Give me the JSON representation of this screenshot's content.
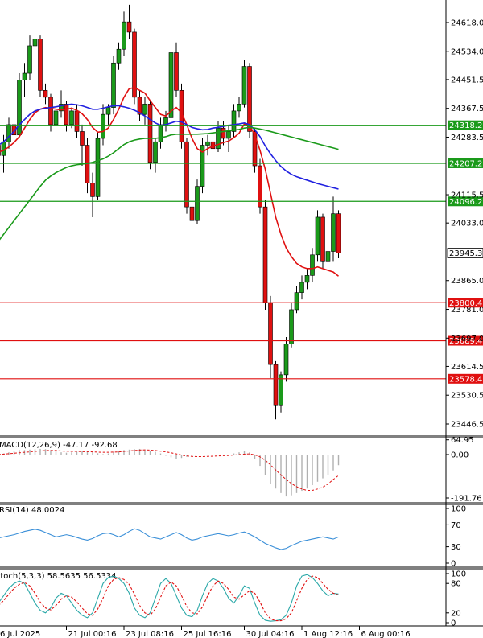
{
  "chart_data": [
    {
      "type": "candlestick",
      "title": "",
      "ylim": [
        23400,
        24680
      ],
      "y_ticks": [
        "24618.0",
        "24534.0",
        "24451.5",
        "24367.5",
        "24283.5",
        "24115.5",
        "24033.0",
        "23865.0",
        "23781.0",
        "23697.0",
        "23614.5",
        "23530.5",
        "23446.5"
      ],
      "x_ticks": [
        "6 Jul 2025",
        "21 Jul 00:16",
        "23 Jul 08:16",
        "25 Jul 16:16",
        "30 Jul 04:16",
        "1 Aug 12:16",
        "6 Aug 00:16"
      ],
      "x_tick_index": [
        0,
        13,
        24,
        35,
        47,
        58,
        69
      ],
      "current_price": "23945.3",
      "horizontal_levels": [
        {
          "value": 24318.2,
          "label": "24318.2",
          "color": "#1a9a1a"
        },
        {
          "value": 24207.2,
          "label": "24207.2",
          "color": "#1a9a1a"
        },
        {
          "value": 24096.2,
          "label": "24096.2",
          "color": "#1a9a1a"
        },
        {
          "value": 23800.4,
          "label": "23800.4",
          "color": "#e01010"
        },
        {
          "value": 23689.4,
          "label": "23689.4",
          "color": "#e01010"
        },
        {
          "value": 23578.4,
          "label": "23578.4",
          "color": "#e01010"
        }
      ],
      "candles": [
        [
          24260,
          24300,
          24200,
          24230
        ],
        [
          24230,
          24290,
          24180,
          24270
        ],
        [
          24270,
          24340,
          24250,
          24320
        ],
        [
          24320,
          24360,
          24270,
          24290
        ],
        [
          24290,
          24470,
          24280,
          24450
        ],
        [
          24450,
          24500,
          24400,
          24470
        ],
        [
          24470,
          24580,
          24450,
          24550
        ],
        [
          24550,
          24590,
          24520,
          24570
        ],
        [
          24570,
          24580,
          24400,
          24420
        ],
        [
          24420,
          24440,
          24380,
          24400
        ],
        [
          24400,
          24410,
          24300,
          24320
        ],
        [
          24320,
          24400,
          24290,
          24360
        ],
        [
          24360,
          24420,
          24340,
          24380
        ],
        [
          24380,
          24390,
          24300,
          24320
        ],
        [
          24320,
          24370,
          24310,
          24360
        ],
        [
          24360,
          24380,
          24280,
          24300
        ],
        [
          24300,
          24320,
          24200,
          24260
        ],
        [
          24260,
          24280,
          24120,
          24150
        ],
        [
          24150,
          24180,
          24050,
          24110
        ],
        [
          24110,
          24300,
          24100,
          24280
        ],
        [
          24280,
          24380,
          24260,
          24350
        ],
        [
          24350,
          24380,
          24320,
          24370
        ],
        [
          24370,
          24520,
          24350,
          24500
        ],
        [
          24500,
          24560,
          24480,
          24540
        ],
        [
          24540,
          24650,
          24520,
          24620
        ],
        [
          24620,
          24670,
          24570,
          24590
        ],
        [
          24590,
          24600,
          24380,
          24400
        ],
        [
          24400,
          24420,
          24330,
          24350
        ],
        [
          24350,
          24400,
          24320,
          24380
        ],
        [
          24380,
          24390,
          24190,
          24210
        ],
        [
          24210,
          24280,
          24180,
          24270
        ],
        [
          24270,
          24340,
          24250,
          24320
        ],
        [
          24320,
          24360,
          24300,
          24340
        ],
        [
          24340,
          24550,
          24330,
          24530
        ],
        [
          24530,
          24560,
          24400,
          24420
        ],
        [
          24420,
          24440,
          24250,
          24270
        ],
        [
          24270,
          24280,
          24060,
          24080
        ],
        [
          24080,
          24100,
          24010,
          24040
        ],
        [
          24040,
          24160,
          24030,
          24140
        ],
        [
          24140,
          24280,
          24120,
          24260
        ],
        [
          24260,
          24290,
          24230,
          24270
        ],
        [
          24270,
          24290,
          24220,
          24250
        ],
        [
          24250,
          24330,
          24240,
          24310
        ],
        [
          24310,
          24330,
          24260,
          24280
        ],
        [
          24280,
          24320,
          24240,
          24300
        ],
        [
          24300,
          24380,
          24280,
          24360
        ],
        [
          24360,
          24400,
          24340,
          24380
        ],
        [
          24380,
          24510,
          24370,
          24490
        ],
        [
          24490,
          24500,
          24280,
          24300
        ],
        [
          24300,
          24310,
          24180,
          24200
        ],
        [
          24200,
          24220,
          24060,
          24080
        ],
        [
          24080,
          24100,
          23780,
          23800
        ],
        [
          23800,
          23820,
          23580,
          23620
        ],
        [
          23620,
          23630,
          23460,
          23500
        ],
        [
          23500,
          23600,
          23480,
          23590
        ],
        [
          23590,
          23700,
          23570,
          23680
        ],
        [
          23680,
          23800,
          23670,
          23780
        ],
        [
          23780,
          23850,
          23770,
          23830
        ],
        [
          23830,
          23880,
          23810,
          23860
        ],
        [
          23860,
          23900,
          23840,
          23880
        ],
        [
          23880,
          23960,
          23860,
          23940
        ],
        [
          23940,
          24070,
          23920,
          24050
        ],
        [
          24050,
          24060,
          23900,
          23920
        ],
        [
          23920,
          23970,
          23900,
          23950
        ],
        [
          23950,
          24110,
          23920,
          24060
        ],
        [
          24060,
          24070,
          23930,
          23945
        ]
      ],
      "series": [
        {
          "name": "",
          "color": "#e01010",
          "values": [
            24240,
            24245,
            24255,
            24268,
            24285,
            24310,
            24335,
            24355,
            24365,
            24370,
            24368,
            24365,
            24363,
            24365,
            24368,
            24362,
            24352,
            24335,
            24312,
            24298,
            24300,
            24310,
            24335,
            24365,
            24400,
            24425,
            24428,
            24420,
            24412,
            24390,
            24370,
            24350,
            24345,
            24360,
            24370,
            24355,
            24320,
            24280,
            24250,
            24240,
            24250,
            24258,
            24262,
            24268,
            24272,
            24282,
            24295,
            24322,
            24318,
            24290,
            24245,
            24190,
            24120,
            24050,
            24000,
            23960,
            23935,
            23915,
            23905,
            23900,
            23900,
            23905,
            23900,
            23895,
            23890,
            23878
          ]
        },
        {
          "name": "",
          "color": "#2020e0",
          "values": [
            24260,
            24270,
            24285,
            24300,
            24320,
            24335,
            24350,
            24360,
            24365,
            24368,
            24370,
            24372,
            24375,
            24378,
            24380,
            24378,
            24375,
            24370,
            24365,
            24365,
            24368,
            24372,
            24375,
            24375,
            24372,
            24368,
            24362,
            24355,
            24345,
            24335,
            24325,
            24318,
            24320,
            24325,
            24330,
            24328,
            24320,
            24312,
            24308,
            24305,
            24306,
            24310,
            24312,
            24315,
            24318,
            24320,
            24322,
            24325,
            24320,
            24305,
            24285,
            24258,
            24235,
            24215,
            24198,
            24185,
            24175,
            24168,
            24163,
            24158,
            24153,
            24148,
            24144,
            24140,
            24136,
            24132
          ]
        },
        {
          "name": "",
          "color": "#1a9a1a",
          "values": [
            23980,
            24000,
            24020,
            24040,
            24060,
            24080,
            24100,
            24120,
            24140,
            24158,
            24170,
            24180,
            24188,
            24195,
            24200,
            24203,
            24205,
            24207,
            24210,
            24215,
            24220,
            24228,
            24238,
            24250,
            24262,
            24270,
            24275,
            24278,
            24280,
            24280,
            24280,
            24282,
            24285,
            24290,
            24292,
            24292,
            24292,
            24292,
            24292,
            24293,
            24294,
            24296,
            24298,
            24300,
            24302,
            24304,
            24306,
            24310,
            24312,
            24310,
            24307,
            24304,
            24300,
            24296,
            24292,
            24288,
            24284,
            24280,
            24276,
            24272,
            24268,
            24264,
            24260,
            24256,
            24252,
            24248
          ]
        }
      ]
    },
    {
      "type": "histogram+line",
      "title": "MACD(12,26,9) -47.17 -92.68",
      "ylim": [
        -200,
        80
      ],
      "y_ticks": [
        "64.95",
        "0.00",
        "-191.76"
      ],
      "histogram": [
        0,
        5,
        10,
        15,
        20,
        20,
        22,
        24,
        25,
        24,
        20,
        15,
        10,
        8,
        10,
        12,
        14,
        12,
        10,
        6,
        2,
        5,
        10,
        15,
        20,
        22,
        24,
        25,
        22,
        18,
        12,
        5,
        -5,
        -12,
        -18,
        -15,
        -10,
        -5,
        -3,
        0,
        -2,
        -3,
        -4,
        -3,
        -1,
        5,
        10,
        15,
        10,
        -20,
        -50,
        -90,
        -130,
        -150,
        -170,
        -185,
        -180,
        -170,
        -160,
        -150,
        -135,
        -120,
        -105,
        -90,
        -70,
        -47
      ],
      "signal": [
        0,
        2,
        4,
        6,
        8,
        10,
        12,
        14,
        16,
        18,
        18,
        18,
        16,
        15,
        14,
        14,
        13,
        13,
        12,
        11,
        10,
        10,
        11,
        12,
        14,
        16,
        18,
        20,
        21,
        20,
        18,
        15,
        12,
        8,
        3,
        -2,
        -6,
        -8,
        -9,
        -9,
        -8,
        -7,
        -6,
        -5,
        -4,
        -2,
        0,
        2,
        3,
        -1,
        -10,
        -25,
        -45,
        -68,
        -90,
        -110,
        -128,
        -142,
        -152,
        -158,
        -158,
        -152,
        -144,
        -130,
        -110,
        -92.68
      ]
    },
    {
      "type": "line",
      "title": "RSI(14) 48.0024",
      "ylim": [
        0,
        100
      ],
      "y_ticks": [
        "100",
        "70",
        "30",
        "0"
      ],
      "series": [
        {
          "name": "",
          "color": "#3a8fd8",
          "values": [
            46,
            48,
            50,
            52,
            55,
            58,
            60,
            62,
            60,
            56,
            52,
            48,
            50,
            52,
            50,
            47,
            44,
            42,
            45,
            50,
            54,
            55,
            52,
            48,
            52,
            58,
            63,
            60,
            54,
            48,
            46,
            44,
            48,
            52,
            56,
            52,
            46,
            42,
            44,
            48,
            50,
            52,
            54,
            52,
            50,
            52,
            55,
            57,
            53,
            48,
            42,
            36,
            32,
            28,
            25,
            27,
            32,
            36,
            40,
            42,
            44,
            46,
            48,
            46,
            44,
            48
          ]
        }
      ]
    },
    {
      "type": "line",
      "title": "Stoch(5,3,3) 58.5635 56.5334",
      "ylim": [
        0,
        100
      ],
      "y_ticks": [
        "100",
        "80",
        "20",
        "0"
      ],
      "series": [
        {
          "name": "",
          "color": "#2aa8a8",
          "values": [
            40,
            55,
            70,
            80,
            85,
            80,
            60,
            40,
            25,
            20,
            30,
            50,
            60,
            55,
            40,
            25,
            15,
            10,
            20,
            50,
            80,
            92,
            95,
            90,
            80,
            60,
            30,
            15,
            10,
            20,
            50,
            80,
            90,
            80,
            55,
            30,
            15,
            12,
            25,
            55,
            80,
            90,
            85,
            70,
            50,
            40,
            55,
            75,
            70,
            40,
            15,
            5,
            3,
            4,
            6,
            15,
            40,
            75,
            95,
            98,
            92,
            80,
            65,
            55,
            60,
            58.56
          ]
        },
        {
          "name": "",
          "color": "#e01010",
          "values": [
            35,
            45,
            58,
            70,
            78,
            82,
            75,
            60,
            42,
            30,
            26,
            35,
            48,
            55,
            52,
            42,
            30,
            18,
            15,
            28,
            50,
            75,
            88,
            92,
            88,
            78,
            58,
            35,
            20,
            15,
            28,
            52,
            75,
            83,
            75,
            55,
            33,
            20,
            18,
            32,
            55,
            75,
            85,
            80,
            68,
            52,
            48,
            57,
            65,
            60,
            42,
            20,
            8,
            4,
            4,
            8,
            20,
            45,
            70,
            88,
            95,
            92,
            80,
            68,
            60,
            56.53
          ]
        }
      ]
    }
  ]
}
